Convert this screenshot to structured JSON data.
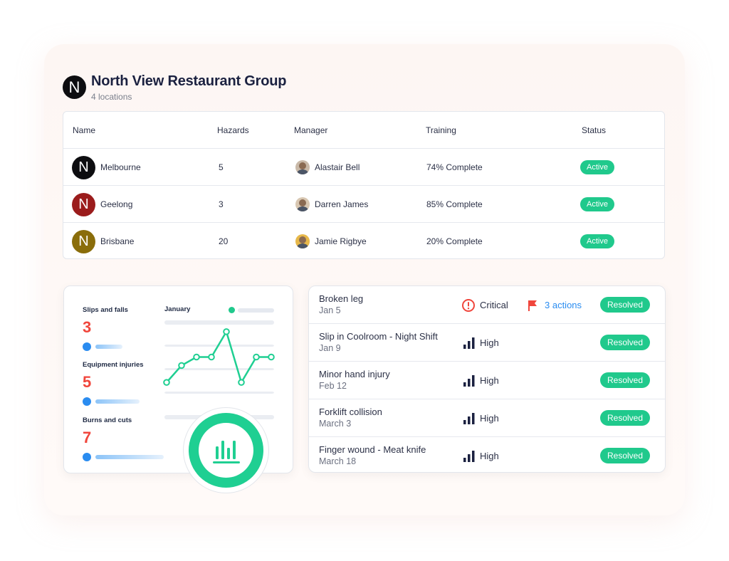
{
  "organization": {
    "logo_letter": "N",
    "name": "North View Restaurant Group",
    "subtitle": "4 locations"
  },
  "table": {
    "headers": {
      "name": "Name",
      "hazards": "Hazards",
      "manager": "Manager",
      "training": "Training",
      "status": "Status"
    },
    "rows": [
      {
        "avatar_letter": "N",
        "avatar_color": "#0d0d10",
        "name": "Melbourne",
        "hazards": "5",
        "manager": "Alastair Bell",
        "training": "74% Complete",
        "status": "Active"
      },
      {
        "avatar_letter": "N",
        "avatar_color": "#9b1c1c",
        "name": "Geelong",
        "hazards": "3",
        "manager": "Darren James",
        "training": "85% Complete",
        "status": "Active"
      },
      {
        "avatar_letter": "N",
        "avatar_color": "#8a6d0a",
        "name": "Brisbane",
        "hazards": "20",
        "manager": "Jamie Rigbye",
        "training": "20% Complete",
        "status": "Active"
      }
    ]
  },
  "stats": {
    "items": [
      {
        "label": "Slips and falls",
        "value": "3"
      },
      {
        "label": "Equipment injuries",
        "value": "5"
      },
      {
        "label": "Burns and cuts",
        "value": "7"
      }
    ],
    "month_label": "January",
    "chart_icon": "bar-chart-icon"
  },
  "chart_data": {
    "type": "line",
    "series": [
      {
        "values": [
          1,
          3,
          4,
          4,
          7,
          1,
          4,
          4
        ]
      }
    ],
    "ylim": [
      0,
      8
    ],
    "grid": true
  },
  "incidents": [
    {
      "title": "Broken leg",
      "date": "Jan 5",
      "severity": "Critical",
      "severity_icon": "alert-circle-icon",
      "actions": "3 actions",
      "actions_icon": "flag-icon",
      "status": "Resolved"
    },
    {
      "title": "Slip in Coolroom - Night Shift",
      "date": "Jan 9",
      "severity": "High",
      "severity_icon": "signal-bars-icon",
      "status": "Resolved"
    },
    {
      "title": "Minor hand injury",
      "date": "Feb 12",
      "severity": "High",
      "severity_icon": "signal-bars-icon",
      "status": "Resolved"
    },
    {
      "title": "Forklift collision",
      "date": "March 3",
      "severity": "High",
      "severity_icon": "signal-bars-icon",
      "status": "Resolved"
    },
    {
      "title": "Finger wound - Meat knife",
      "date": "March 18",
      "severity": "High",
      "severity_icon": "signal-bars-icon",
      "status": "Resolved"
    }
  ],
  "colors": {
    "accent_green": "#20c98c",
    "critical_red": "#f0463c",
    "link_blue": "#2a8cf0",
    "navy": "#1b2140"
  }
}
